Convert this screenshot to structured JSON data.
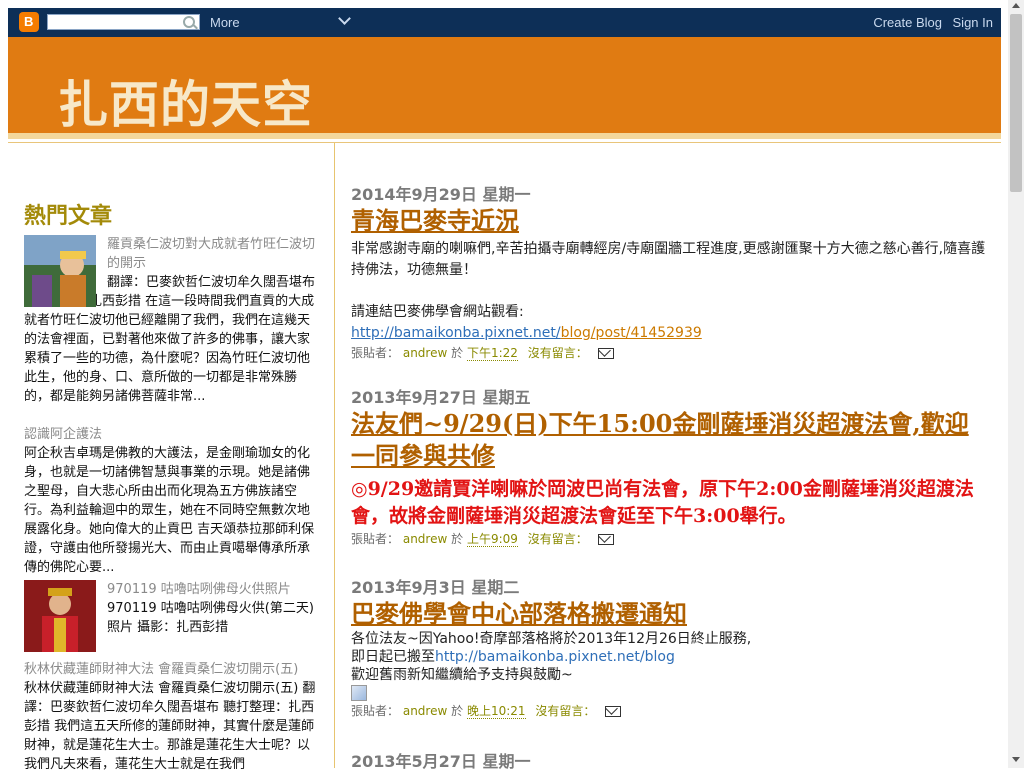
{
  "navbar": {
    "logo_letter": "B",
    "more": "More",
    "create_blog": "Create Blog",
    "sign_in": "Sign In"
  },
  "header": {
    "title": "扎西的天空"
  },
  "sidebar": {
    "title": "熱門文章",
    "items": [
      {
        "title": "羅貢桑仁波切對大成就者竹旺仁波切的開示",
        "snippet": "翻譯：巴麥欽哲仁波切牟久闊吾堪布 聽打整理：扎西彭措 在這一段時間我們直貢的大成就者竹旺仁波切他已經離開了我們，我們在這幾天的法會裡面，已對著他來做了許多的佛事，讓大家累積了一些的功德，為什麼呢？因為竹旺仁波切他此生，他的身、口、意所做的一切都是非常殊勝的，都是能夠另諸佛菩薩非常..."
      },
      {
        "title": "認識阿企護法",
        "snippet": "阿企秋吉卓瑪是佛教的大護法，是金剛瑜珈女的化身，也就是一切諸佛智慧與事業的示現。她是諸佛之聖母，自大悲心所由出而化現為五方佛族諸空行。為利益輪迴中的眾生，她在不同時空無數次地展露化身。她向偉大的止貢巴 吉天頌恭拉那師利保證，守護由他所發揚光大、而由止貢噶舉傳承所承傳的佛陀心要..."
      },
      {
        "title": "970119 咕嚕咕咧佛母火供照片",
        "snippet": "970119 咕嚕咕咧佛母火供(第二天) 照片 攝影：扎西彭措"
      },
      {
        "title": "秋林伏藏蓮師財神大法 會羅貢桑仁波切開示(五)",
        "snippet": "秋林伏藏蓮師財神大法 會羅貢桑仁波切開示(五) 翻譯：巴麥欽哲仁波切牟久闊吾堪布 聽打整理：扎西彭措 我們這五天所修的蓮師財神，其實什麼是蓮師財神，就是蓮花生大士。那誰是蓮花生大士呢？以我們凡夫來看，蓮花生大士就是在我們"
      }
    ]
  },
  "posts": [
    {
      "date": "2014年9月29日 星期一",
      "title": "青海巴麥寺近況",
      "body_line1": "非常感謝寺廟的喇嘛們,辛苦拍攝寺廟轉經房/寺廟圍牆工程進度,更感謝匯聚十方大德之慈心善行,隨喜護持佛法，功德無量！",
      "body_line2": "請連結巴麥佛學會網站觀看:",
      "link_part1": "http://bamaikonba.pixnet.net/",
      "link_part2": "blog/post/41452939",
      "footer": {
        "posted_by": "張貼者：",
        "author": "andrew",
        "at": "於",
        "time": "下午1:22",
        "comments": "沒有留言："
      }
    },
    {
      "date": "2013年9月27日 星期五",
      "title": "法友們~9/29(日)下午15:00金剛薩埵消災超渡法會,歡迎一同參與共修",
      "red": "◎9/29邀請賈洋喇嘛於岡波巴尚有法會，原下午2:00金剛薩埵消災超渡法會，故將金剛薩埵消災超渡法會延至下午3:00舉行。",
      "footer": {
        "posted_by": "張貼者：",
        "author": "andrew",
        "at": "於",
        "time": "上午9:09",
        "comments": "沒有留言："
      }
    },
    {
      "date": "2013年9月3日 星期二",
      "title": "巴麥佛學會中心部落格搬遷通知",
      "line1": "各位法友~因Yahoo!奇摩部落格將於2013年12月26日終止服務,",
      "line2_prefix": "即日起已搬至",
      "line2_link": "http://bamaikonba.pixnet.net/blog",
      "line3": "歡迎舊雨新知繼續給予支持與鼓勵~",
      "footer": {
        "posted_by": "張貼者：",
        "author": "andrew",
        "at": "於",
        "time": "晚上10:21",
        "comments": "沒有留言："
      }
    },
    {
      "date": "2013年5月27日 星期一"
    }
  ]
}
